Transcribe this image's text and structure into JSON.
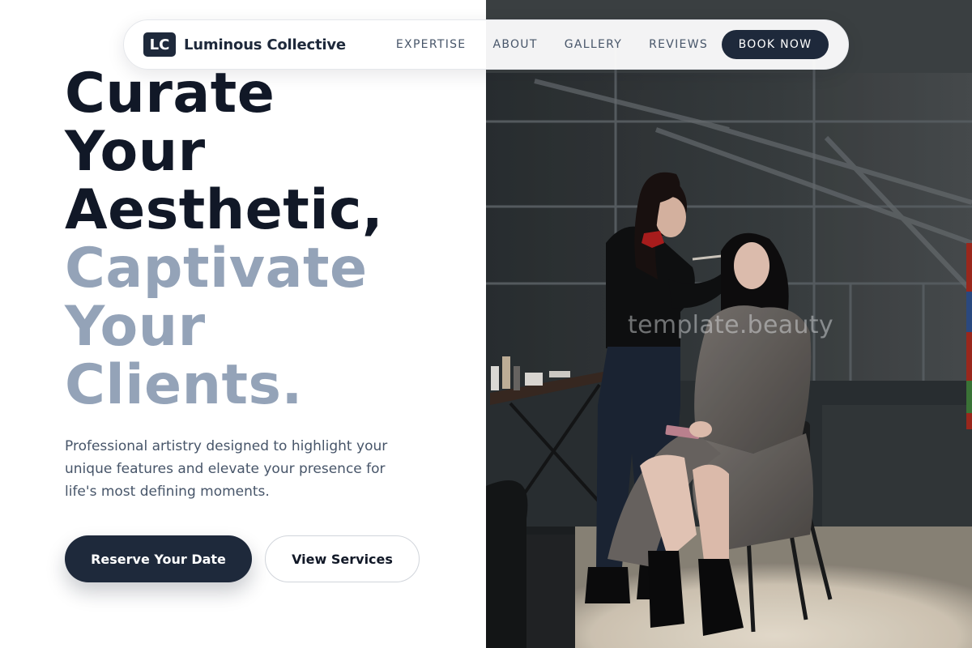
{
  "nav": {
    "logo_mark": "LC",
    "brand": "Luminous Collective",
    "links": [
      "EXPERTISE",
      "ABOUT",
      "GALLERY",
      "REVIEWS"
    ],
    "cta": "BOOK NOW"
  },
  "hero": {
    "title_dark": [
      "Curate",
      "Your",
      "Aesthetic,"
    ],
    "title_muted": [
      "Captivate",
      "Your",
      "Clients."
    ],
    "subtitle": "Professional artistry designed to highlight your unique features and elevate your presence for life's most defining moments.",
    "primary_cta": "Reserve Your Date",
    "secondary_cta": "View Services"
  },
  "image": {
    "watermark": "template.beauty"
  },
  "colors": {
    "primary": "#1e293b",
    "heading": "#111827",
    "muted_heading": "#94a3b8",
    "body_text": "#475569"
  }
}
